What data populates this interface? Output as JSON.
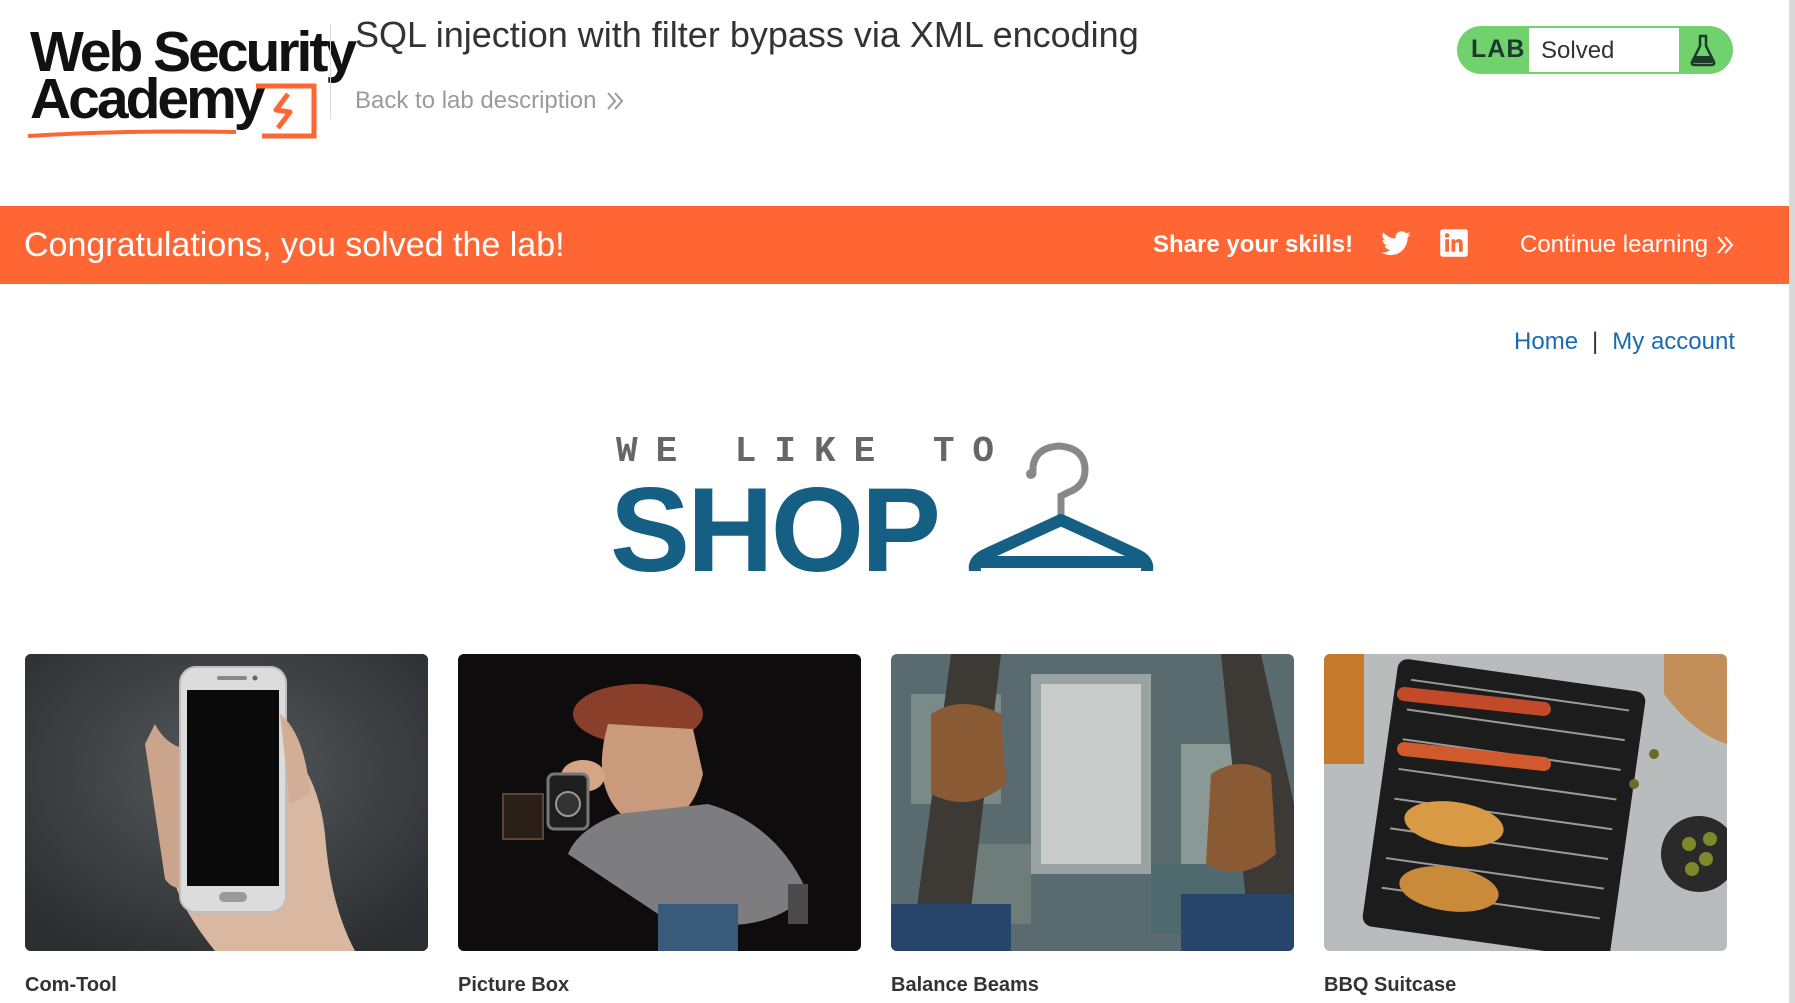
{
  "header": {
    "logo_line1": "Web Security",
    "logo_line2": "Academy",
    "lab_title": "SQL injection with filter bypass via XML encoding",
    "back_link": "Back to lab description",
    "lab_badge": "LAB",
    "lab_status": "Solved",
    "lab_icon": "flask-icon"
  },
  "banner": {
    "message": "Congratulations, you solved the lab!",
    "share_label": "Share your skills!",
    "continue_label": "Continue learning",
    "color": "#ff6633"
  },
  "nav": {
    "home": "Home",
    "separator": "|",
    "account": "My account"
  },
  "hero": {
    "tagline": "WE LIKE TO",
    "title": "SHOP",
    "color": "#155f85"
  },
  "products": [
    {
      "name": "Com-Tool",
      "image": "phone-in-hand"
    },
    {
      "name": "Picture Box",
      "image": "photographer-figurine"
    },
    {
      "name": "Balance Beams",
      "image": "feet-over-city"
    },
    {
      "name": "BBQ Suitcase",
      "image": "portable-grill"
    }
  ]
}
